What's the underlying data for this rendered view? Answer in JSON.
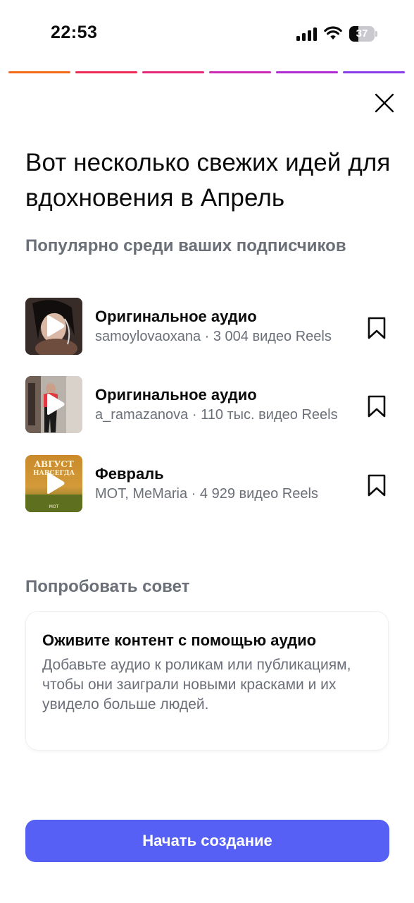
{
  "status_bar": {
    "time": "22:53",
    "battery_percent": "37",
    "battery_level": 0.37,
    "icons": [
      "signal-icon",
      "wifi-icon",
      "battery-icon"
    ]
  },
  "story_progress": {
    "segments": 6,
    "colors": [
      "#f26b1d",
      "#ee2a55",
      "#e5287a",
      "#c92bb4",
      "#b22ad2",
      "#8a3ee8"
    ]
  },
  "close_icon": "close-icon",
  "headline": "Вот несколько свежих идей для вдохновения в Апрель",
  "popular_section": {
    "title": "Популярно среди ваших подписчиков",
    "items": [
      {
        "title": "Оригинальное аудио",
        "subtitle": "samoylovaoxana · 3 004 видео Reels",
        "thumb_icon": "play-icon",
        "bookmark_icon": "bookmark-icon"
      },
      {
        "title": "Оригинальное аудио",
        "subtitle": "a_ramazanova · 110 тыс. видео Reels",
        "thumb_icon": "play-icon",
        "bookmark_icon": "bookmark-icon"
      },
      {
        "title": "Февраль",
        "subtitle": "MOT, MeMaria · 4 929 видео Reels",
        "thumb_icon": "play-icon",
        "bookmark_icon": "bookmark-icon",
        "cover_text": [
          "АВГУСТ",
          "НАВСЕГДА",
          "МОТ"
        ]
      }
    ]
  },
  "tip_section": {
    "title": "Попробовать совет",
    "card_title": "Оживите контент с помощью аудио",
    "card_body": "Добавьте аудио к роликам или публикациям, чтобы они заиграли новыми красками и их увидело больше людей."
  },
  "cta": {
    "label": "Начать создание",
    "color": "#5660f4"
  }
}
